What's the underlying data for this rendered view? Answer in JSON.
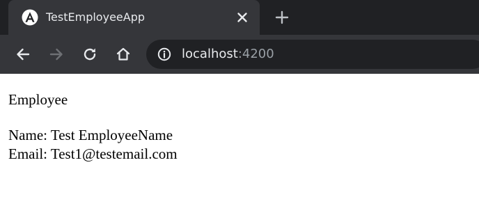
{
  "browser": {
    "tab": {
      "title": "TestEmployeeApp",
      "favicon_icon": "angular-logo-icon",
      "close_icon": "close-icon"
    },
    "new_tab_icon": "plus-icon",
    "toolbar": {
      "back_icon": "arrow-left-icon",
      "forward_icon": "arrow-right-icon",
      "forward_enabled": false,
      "reload_icon": "reload-icon",
      "home_icon": "home-icon"
    },
    "address_bar": {
      "info_icon": "info-icon",
      "host": "localhost",
      "port": ":4200"
    },
    "colors": {
      "tabstrip_bg": "#202124",
      "active_tab_bg": "#35363a",
      "omnibox_bg": "#202124",
      "text_primary": "#e8eaed",
      "text_muted": "#9aa0a6"
    }
  },
  "page": {
    "heading": "Employee",
    "name_line": "Name: Test EmployeeName",
    "email_line": "Email: Test1@testemail.com"
  }
}
